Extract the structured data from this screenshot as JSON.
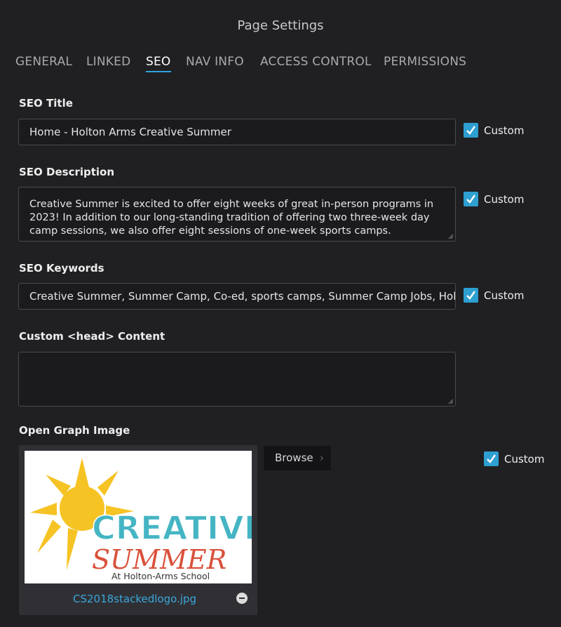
{
  "page": {
    "title": "Page Settings"
  },
  "tabs": [
    "GENERAL",
    "LINKED",
    "SEO",
    "NAV INFO",
    "ACCESS CONTROL",
    "PERMISSIONS"
  ],
  "active_tab": "SEO",
  "seo_title": {
    "label": "SEO Title",
    "value": "Home - Holton Arms Creative Summer",
    "custom_label": "Custom",
    "custom_checked": true
  },
  "seo_description": {
    "label": "SEO Description",
    "value": "Creative Summer is excited to offer eight weeks of great in-person programs in 2023! In addition to our long-standing tradition of offering two three-week day camp sessions, we also offer eight sessions of one-week sports camps.",
    "custom_label": "Custom",
    "custom_checked": true
  },
  "seo_keywords": {
    "label": "SEO Keywords",
    "value": "Creative Summer, Summer Camp, Co-ed, sports camps, Summer Camp Jobs, Holto",
    "custom_label": "Custom",
    "custom_checked": true
  },
  "custom_head": {
    "label": "Custom <head> Content",
    "value": ""
  },
  "og_image": {
    "label": "Open Graph Image",
    "browse_label": "Browse",
    "filename": "CS2018stackedlogo.jpg",
    "custom_label": "Custom",
    "custom_checked": true,
    "logo": {
      "line1": "CREATIVE",
      "line2": "SUMMER",
      "line3": "At Holton-Arms School"
    }
  },
  "colors": {
    "accent": "#2e9fd1",
    "background": "#202023",
    "logo_teal": "#45b5c4",
    "logo_red": "#d9513a",
    "logo_sun": "#f6c324"
  }
}
